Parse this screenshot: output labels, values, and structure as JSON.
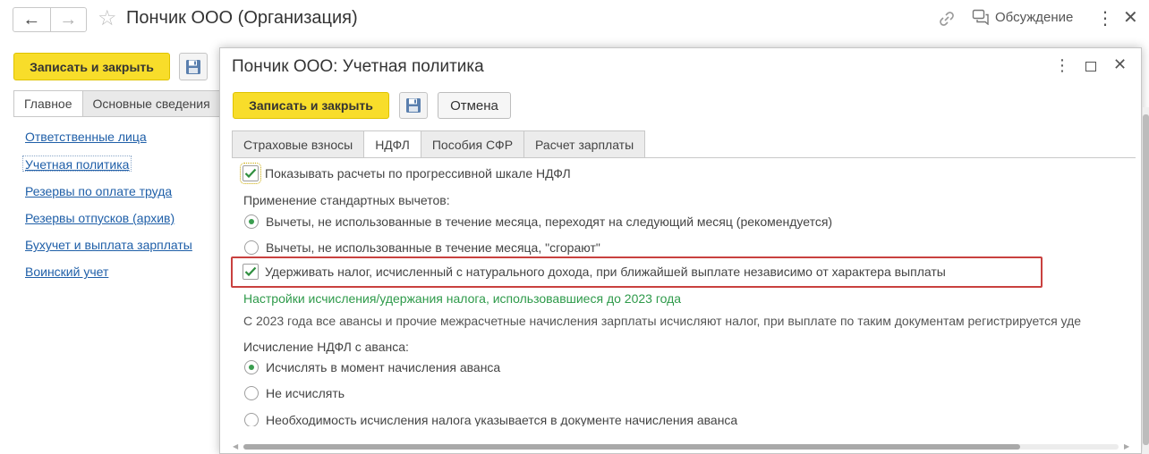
{
  "window": {
    "title": "Пончик ООО (Организация)",
    "discuss_label": "Обсуждение"
  },
  "main": {
    "save_close_label": "Записать и закрыть",
    "tabs": [
      {
        "label": "Главное"
      },
      {
        "label": "Основные сведения"
      }
    ],
    "links": [
      {
        "label": "Ответственные лица"
      },
      {
        "label": "Учетная политика"
      },
      {
        "label": "Резервы по оплате труда"
      },
      {
        "label": "Резервы отпусков (архив)"
      },
      {
        "label": "Бухучет и выплата зарплаты"
      },
      {
        "label": "Воинский учет"
      }
    ]
  },
  "dialog": {
    "title": "Пончик ООО: Учетная политика",
    "save_close_label": "Записать и закрыть",
    "cancel_label": "Отмена",
    "tabs": [
      {
        "label": "Страховые взносы"
      },
      {
        "label": "НДФЛ"
      },
      {
        "label": "Пособия СФР"
      },
      {
        "label": "Расчет зарплаты"
      }
    ],
    "active_tab": "НДФЛ",
    "progressive_scale_label": "Показывать расчеты по прогрессивной шкале НДФЛ",
    "progressive_scale_checked": true,
    "deductions_heading": "Применение стандартных вычетов:",
    "deductions_options": [
      {
        "label": "Вычеты, не использованные в течение месяца, переходят на следующий месяц (рекомендуется)",
        "selected": true
      },
      {
        "label": "Вычеты, не использованные в течение месяца, \"сгорают\"",
        "selected": false
      }
    ],
    "withhold_label": "Удерживать налог, исчисленный с натурального дохода, при ближайшей выплате независимо от характера выплаты",
    "withhold_checked": true,
    "legacy_settings_link": "Настройки исчисления/удержания налога, использовавшиеся до 2023 года",
    "info_text": "С 2023 года все авансы и прочие межрасчетные начисления зарплаты исчисляют налог, при выплате по таким документам регистрируется уде",
    "advance_heading": "Исчисление НДФЛ с аванса:",
    "advance_options": [
      {
        "label": "Исчислять в момент начисления аванса",
        "selected": true
      },
      {
        "label": "Не исчислять",
        "selected": false
      },
      {
        "label": "Необходимость исчисления налога указывается в документе начисления аванса",
        "selected": false
      }
    ]
  },
  "colors": {
    "accent_yellow": "#f8dd2a",
    "link_blue": "#1f5fa8",
    "green_text": "#2e9a4a",
    "highlight_red": "#c9413f"
  }
}
